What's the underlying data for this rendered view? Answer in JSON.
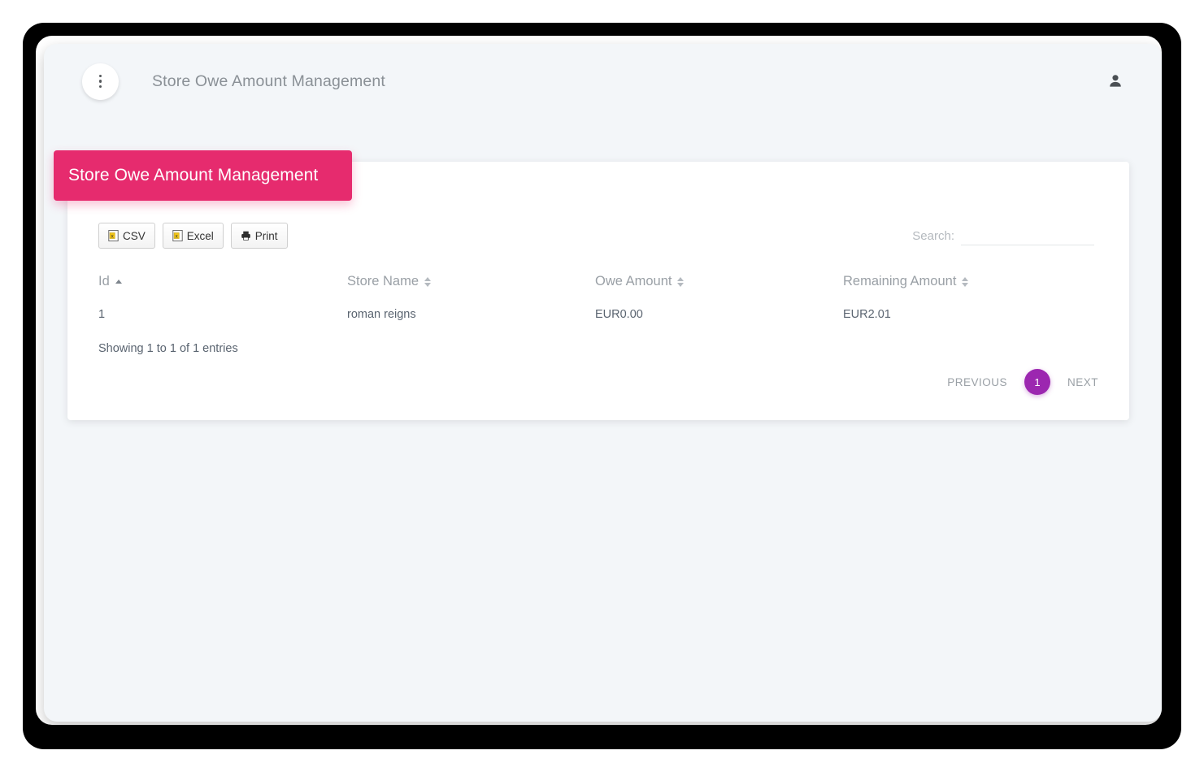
{
  "appbar": {
    "menu_icon": "vertical-dots-icon",
    "title": "Store Owe Amount Management",
    "user_icon": "account-icon"
  },
  "card": {
    "banner_title": "Store Owe Amount Management",
    "banner_color": "#e62b6e"
  },
  "toolbar": {
    "export_buttons": [
      {
        "label": "CSV",
        "icon": "file-excel-icon"
      },
      {
        "label": "Excel",
        "icon": "file-excel-icon"
      },
      {
        "label": "Print",
        "icon": "printer-icon"
      }
    ],
    "search": {
      "label": "Search:",
      "value": "",
      "placeholder": ""
    }
  },
  "table": {
    "columns": [
      {
        "label": "Id",
        "sort": "asc"
      },
      {
        "label": "Store Name",
        "sort": "none"
      },
      {
        "label": "Owe Amount",
        "sort": "none"
      },
      {
        "label": "Remaining Amount",
        "sort": "none"
      }
    ],
    "rows": [
      {
        "id": "1",
        "store_name": "roman reigns",
        "owe_amount": "EUR0.00",
        "remaining_amount": "EUR2.01"
      }
    ],
    "info": "Showing 1 to 1 of 1 entries"
  },
  "pagination": {
    "previous": "PREVIOUS",
    "current_page": "1",
    "next": "NEXT",
    "active_color": "#9c27b0"
  }
}
